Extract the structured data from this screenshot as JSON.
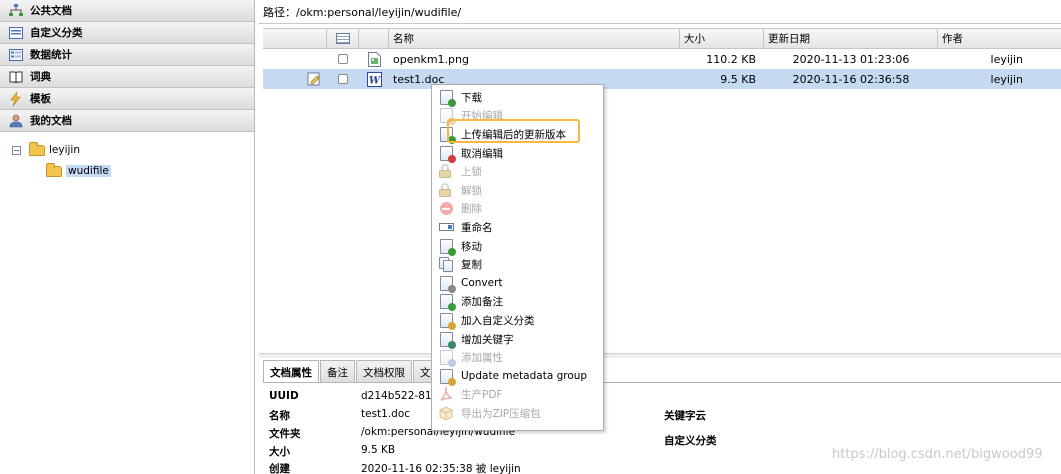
{
  "sidebar": {
    "sections": [
      {
        "label": "公共文档",
        "icon": "taxonomy-icon"
      },
      {
        "label": "自定义分类",
        "icon": "categories-icon"
      },
      {
        "label": "数据统计",
        "icon": "thesaurus-icon"
      },
      {
        "label": "词典",
        "icon": "book-icon"
      },
      {
        "label": "模板",
        "icon": "lightning-icon"
      },
      {
        "label": "我的文档",
        "icon": "user-icon"
      }
    ],
    "tree": {
      "root": "leyijin",
      "child": "wudifile"
    }
  },
  "path": {
    "text": "路径：/okm:personal/leyijin/wudifile/"
  },
  "grid": {
    "columns": {
      "name": "名称",
      "size": "大小",
      "date": "更新日期",
      "author": "作者"
    },
    "rows": [
      {
        "name": "openkm1.png",
        "size": "110.2 KB",
        "date": "2020-11-13 01:23:06",
        "author": "leyijin",
        "type": "png"
      },
      {
        "name": "test1.doc",
        "size": "9.5 KB",
        "date": "2020-11-16 02:36:58",
        "author": "leyijin",
        "type": "doc"
      }
    ]
  },
  "context_menu": {
    "items": [
      {
        "label": "下载",
        "enabled": true,
        "icon": "download-icon",
        "color": "#3a9a3a"
      },
      {
        "label": "开始编辑",
        "enabled": false,
        "icon": "edit-icon",
        "color": "#d9a43a"
      },
      {
        "label": "上传编辑后的更新版本",
        "enabled": true,
        "icon": "checkin-icon",
        "color": "#3a9a3a"
      },
      {
        "label": "取消编辑",
        "enabled": true,
        "icon": "cancel-checkout-icon",
        "color": "#d03c3c"
      },
      {
        "label": "上锁",
        "enabled": false,
        "icon": "lock-icon",
        "color": "#c9a63a"
      },
      {
        "label": "解锁",
        "enabled": false,
        "icon": "unlock-icon",
        "color": "#c9a63a"
      },
      {
        "label": "删除",
        "enabled": false,
        "icon": "delete-icon",
        "color": "#e04848"
      },
      {
        "label": "重命名",
        "enabled": true,
        "icon": "rename-icon",
        "color": "#4a78c8"
      },
      {
        "label": "移动",
        "enabled": true,
        "icon": "move-icon",
        "color": "#3a9a3a"
      },
      {
        "label": "复制",
        "enabled": true,
        "icon": "copy-icon",
        "color": "#4a78c8"
      },
      {
        "label": "Convert",
        "enabled": true,
        "icon": "convert-icon",
        "color": "#888888"
      },
      {
        "label": "添加备注",
        "enabled": true,
        "icon": "add-note-icon",
        "color": "#3a9a3a"
      },
      {
        "label": "加入自定义分类",
        "enabled": true,
        "icon": "add-category-icon",
        "color": "#d9a43a"
      },
      {
        "label": "增加关键字",
        "enabled": true,
        "icon": "add-keyword-icon",
        "color": "#3a8a6a"
      },
      {
        "label": "添加属性",
        "enabled": false,
        "icon": "add-property-icon",
        "color": "#6a8ac8"
      },
      {
        "label": "Update metadata group",
        "enabled": true,
        "icon": "metadata-icon",
        "color": "#d9a43a"
      },
      {
        "label": "生产PDF",
        "enabled": false,
        "icon": "pdf-icon",
        "color": "#d03c3c"
      },
      {
        "label": "导出为ZIP压缩包",
        "enabled": false,
        "icon": "zip-icon",
        "color": "#d9a43a"
      }
    ]
  },
  "tabs": [
    "文档属性",
    "备注",
    "文档权限",
    "文"
  ],
  "properties": {
    "uuid": {
      "k": "UUID",
      "v": "d214b522-81"
    },
    "name": {
      "k": "名称",
      "v": "test1.doc"
    },
    "folder": {
      "k": "文件夹",
      "v": "/okm:personal/leyijin/wudifile"
    },
    "size": {
      "k": "大小",
      "v": "9.5 KB"
    },
    "created": {
      "k": "创建",
      "v": "2020-11-16 02:35:38 被 leyijin"
    },
    "keywords_label": "关键字云",
    "categories_label": "自定义分类"
  },
  "watermark": "https://blog.csdn.net/bigwood99"
}
